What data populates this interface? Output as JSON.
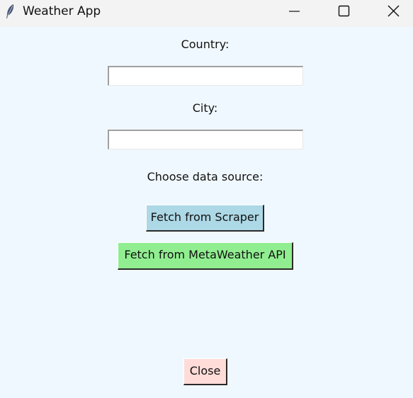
{
  "window": {
    "title": "Weather App",
    "app_icon": "feather-icon",
    "controls": {
      "minimize_icon": "minimize-icon",
      "maximize_icon": "maximize-icon",
      "close_icon": "close-icon"
    }
  },
  "form": {
    "country_label": "Country:",
    "country_value": "",
    "city_label": "City:",
    "city_value": "",
    "source_label": "Choose data source:"
  },
  "buttons": {
    "scraper": {
      "label": "Fetch from Scraper",
      "color": "#add8e6"
    },
    "api": {
      "label": "Fetch from MetaWeather API",
      "color": "#90ee90"
    },
    "close": {
      "label": "Close",
      "color": "#ffdcd8"
    }
  },
  "colors": {
    "background": "#f0f8ff",
    "titlebar": "#f3f3f3"
  }
}
